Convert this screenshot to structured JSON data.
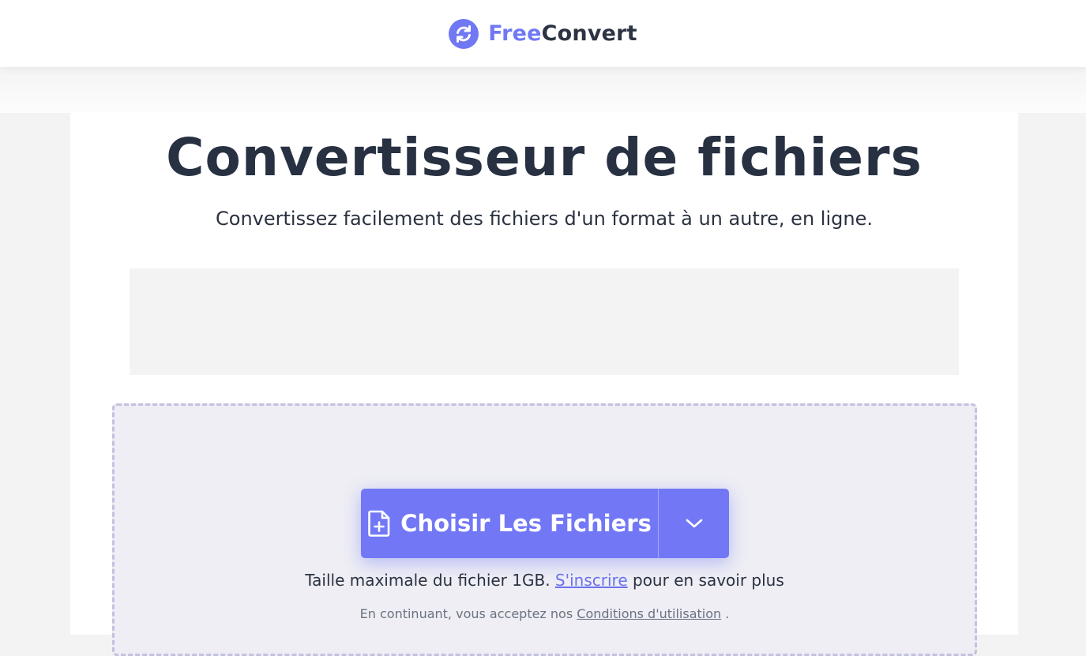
{
  "header": {
    "logo_free": "Free",
    "logo_convert": "Convert",
    "logo_icon": "refresh-circle-icon"
  },
  "main": {
    "title": "Convertisseur de fichiers",
    "subtitle": "Convertissez facilement des fichiers d'un format à un autre, en ligne."
  },
  "upload": {
    "choose_label": "Choisir Les Fichiers",
    "choose_icon": "file-plus-icon",
    "dropdown_icon": "chevron-down-icon",
    "max_size_prefix": "Taille maximale du fichier 1GB.",
    "signup_link": "S'inscrire",
    "max_size_suffix": "pour en savoir plus",
    "terms_prefix": "En continuant, vous acceptez nos",
    "terms_link": "Conditions d'utilisation",
    "terms_suffix": "."
  },
  "colors": {
    "accent": "#7278f5",
    "title_text": "#273142",
    "dropzone_bg": "#eeeef4",
    "dropzone_border": "#c3c1e0"
  }
}
